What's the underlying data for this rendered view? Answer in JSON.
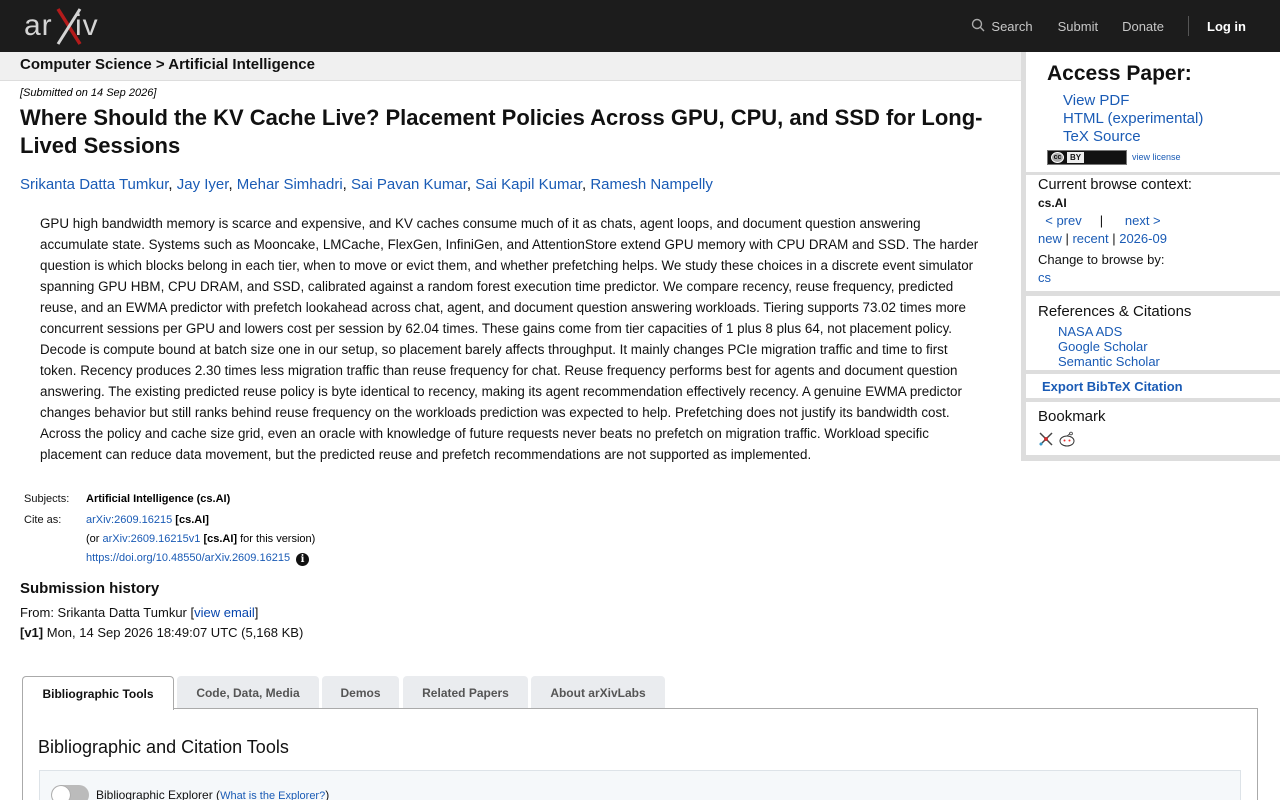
{
  "header": {
    "logo_alt": "arXiv",
    "search_label": "Search",
    "submit_label": "Submit",
    "donate_label": "Donate",
    "login_label": "Log in"
  },
  "breadcrumb": "Computer Science > Artificial Intelligence",
  "paper": {
    "submitted": "[Submitted on 14 Sep 2026]",
    "title": "Where Should the KV Cache Live? Placement Policies Across GPU, CPU, and SSD for Long-Lived Sessions",
    "authors": [
      "Srikanta Datta Tumkur",
      "Jay Iyer",
      "Mehar Simhadri",
      "Sai Pavan Kumar",
      "Sai Kapil Kumar",
      "Ramesh Nampelly"
    ],
    "abstract": "GPU high bandwidth memory is scarce and expensive, and KV caches consume much of it as chats, agent loops, and document question answering accumulate state. Systems such as Mooncake, LMCache, FlexGen, InfiniGen, and AttentionStore extend GPU memory with CPU DRAM and SSD. The harder question is which blocks belong in each tier, when to move or evict them, and whether prefetching helps. We study these choices in a discrete event simulator spanning GPU HBM, CPU DRAM, and SSD, calibrated against a random forest execution time predictor. We compare recency, reuse frequency, predicted reuse, and an EWMA predictor with prefetch lookahead across chat, agent, and document question answering workloads. Tiering supports 73.02 times more concurrent sessions per GPU and lowers cost per session by 62.04 times. These gains come from tier capacities of 1 plus 8 plus 64, not placement policy. Decode is compute bound at batch size one in our setup, so placement barely affects throughput. It mainly changes PCIe migration traffic and time to first token. Recency produces 2.30 times less migration traffic than reuse frequency for chat. Reuse frequency performs best for agents and document question answering. The existing predicted reuse policy is byte identical to recency, making its agent recommendation effectively recency. A genuine EWMA predictor changes behavior but still ranks behind reuse frequency on the workloads prediction was expected to help. Prefetching does not justify its bandwidth cost. Across the policy and cache size grid, even an oracle with knowledge of future requests never beats no prefetch on migration traffic. Workload specific placement can reduce data movement, but the predicted reuse and prefetch recommendations are not supported as implemented."
  },
  "meta": {
    "subjects_label": "Subjects:",
    "subjects_value": "Artificial Intelligence (cs.AI)",
    "cite_label": "Cite as:",
    "cite_id": "arXiv:2609.16215",
    "cite_cat": "[cs.AI]",
    "version_prefix": "(or",
    "version_id": "arXiv:2609.16215v1",
    "version_cat": "[cs.AI]",
    "version_suffix": "for this version)",
    "doi": "https://doi.org/10.48550/arXiv.2609.16215"
  },
  "history": {
    "heading": "Submission history",
    "from_prefix": "From: Srikanta Datta Tumkur [",
    "view_email": "view email",
    "from_suffix": "]",
    "v1_tag": "[v1]",
    "v1_text": " Mon, 14 Sep 2026 18:49:07 UTC (5,168 KB)"
  },
  "tabs": [
    "Bibliographic Tools",
    "Code, Data, Media",
    "Demos",
    "Related Papers",
    "About arXivLabs"
  ],
  "tab_panel": {
    "heading": "Bibliographic and Citation Tools",
    "explorer_label": "Bibliographic Explorer (",
    "explorer_link": "What is the Explorer?",
    "explorer_close": ")"
  },
  "sidebar": {
    "access_heading": "Access Paper:",
    "access_links": [
      "View PDF",
      "HTML (experimental)",
      "TeX Source"
    ],
    "license_badge_cc": "cc",
    "license_badge_by": "BY",
    "view_license": "view license",
    "browse_heading": "Current browse context:",
    "browse_context": "cs.AI",
    "prev": "< prev",
    "nav_sep": "|",
    "next": "next >",
    "new": "new",
    "recent": "recent",
    "month": "2026-09",
    "change_label": "Change to browse by:",
    "change_cs": "cs",
    "refs_heading": "References & Citations",
    "refs_links": [
      "NASA ADS",
      "Google Scholar",
      "Semantic Scholar"
    ],
    "export_bibtex": "Export BibTeX Citation",
    "bookmark_heading": "Bookmark"
  }
}
